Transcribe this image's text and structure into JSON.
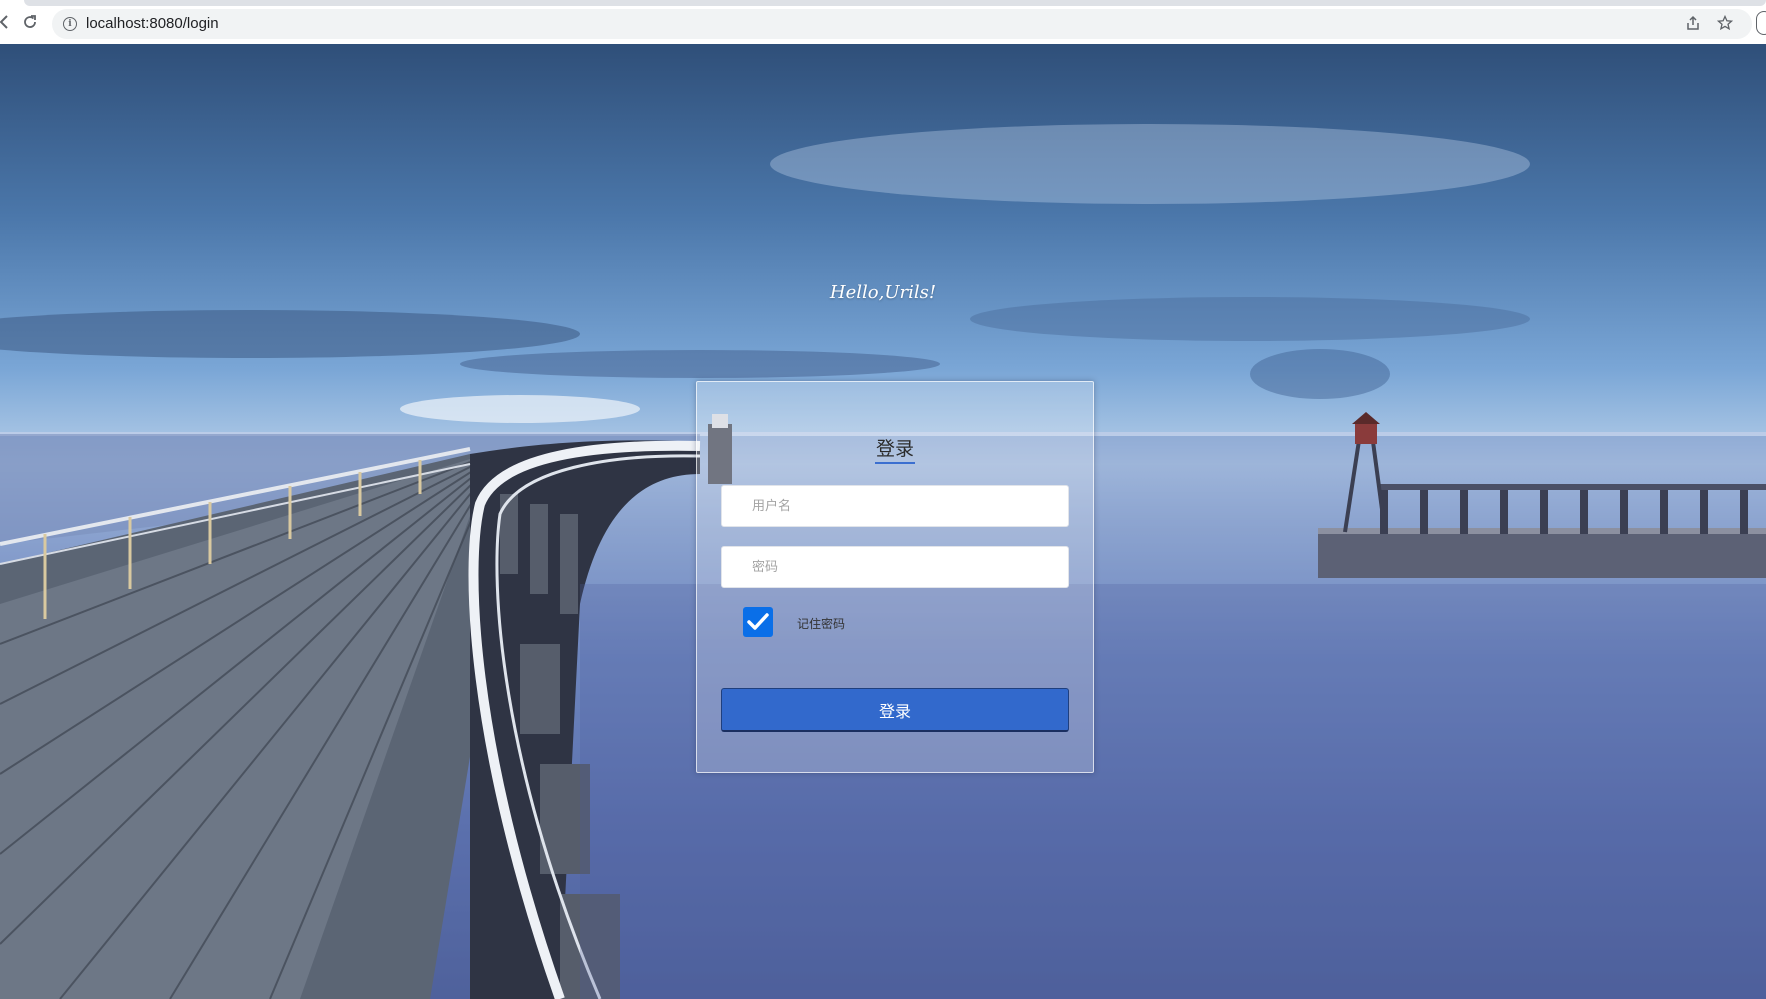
{
  "browser": {
    "url": "localhost:8080/login"
  },
  "page": {
    "greeting": "Hello,Urils!"
  },
  "login": {
    "title": "登录",
    "username_placeholder": "用户名",
    "password_placeholder": "密码",
    "remember_label": "记住密码",
    "remember_checked": true,
    "submit_label": "登录"
  },
  "colors": {
    "accent": "#3269cc",
    "checkbox": "#0a6fe8"
  },
  "icons": {
    "back": "back-arrow-icon",
    "reload": "reload-icon",
    "site_info": "info-icon",
    "share": "share-icon",
    "bookmark": "star-icon"
  }
}
